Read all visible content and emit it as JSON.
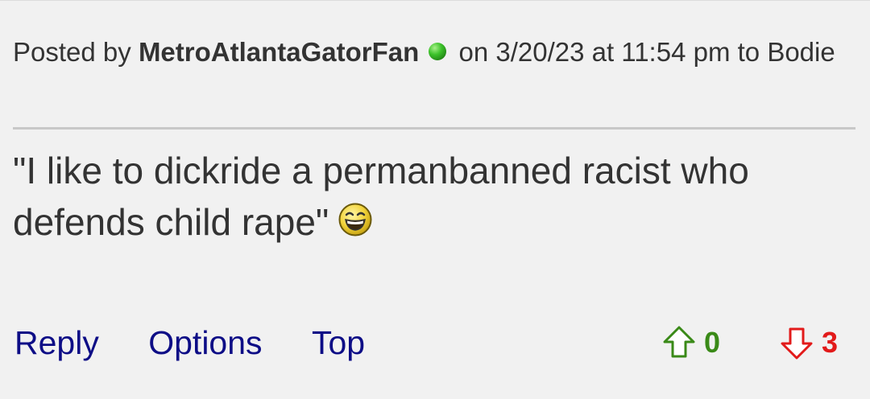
{
  "post": {
    "posted_by_prefix": "Posted by",
    "author": "MetroAtlantaGatorFan",
    "on_text": "on 3/20/23 at 11:54 pm to",
    "reply_to": "Bodie",
    "body": "\"I like to dickride a permanbanned racist who defends child rape\"",
    "emoji_icon": "laughing-smiley-icon",
    "online_status_icon": "green-dot-icon"
  },
  "actions": {
    "reply": "Reply",
    "options": "Options",
    "top": "Top"
  },
  "votes": {
    "up_count": "0",
    "down_count": "3",
    "up_color": "#3a8a18",
    "down_color": "#e21a1a"
  },
  "colors": {
    "background": "#f1f1f1",
    "text": "#333333",
    "link": "#0d0d86"
  }
}
